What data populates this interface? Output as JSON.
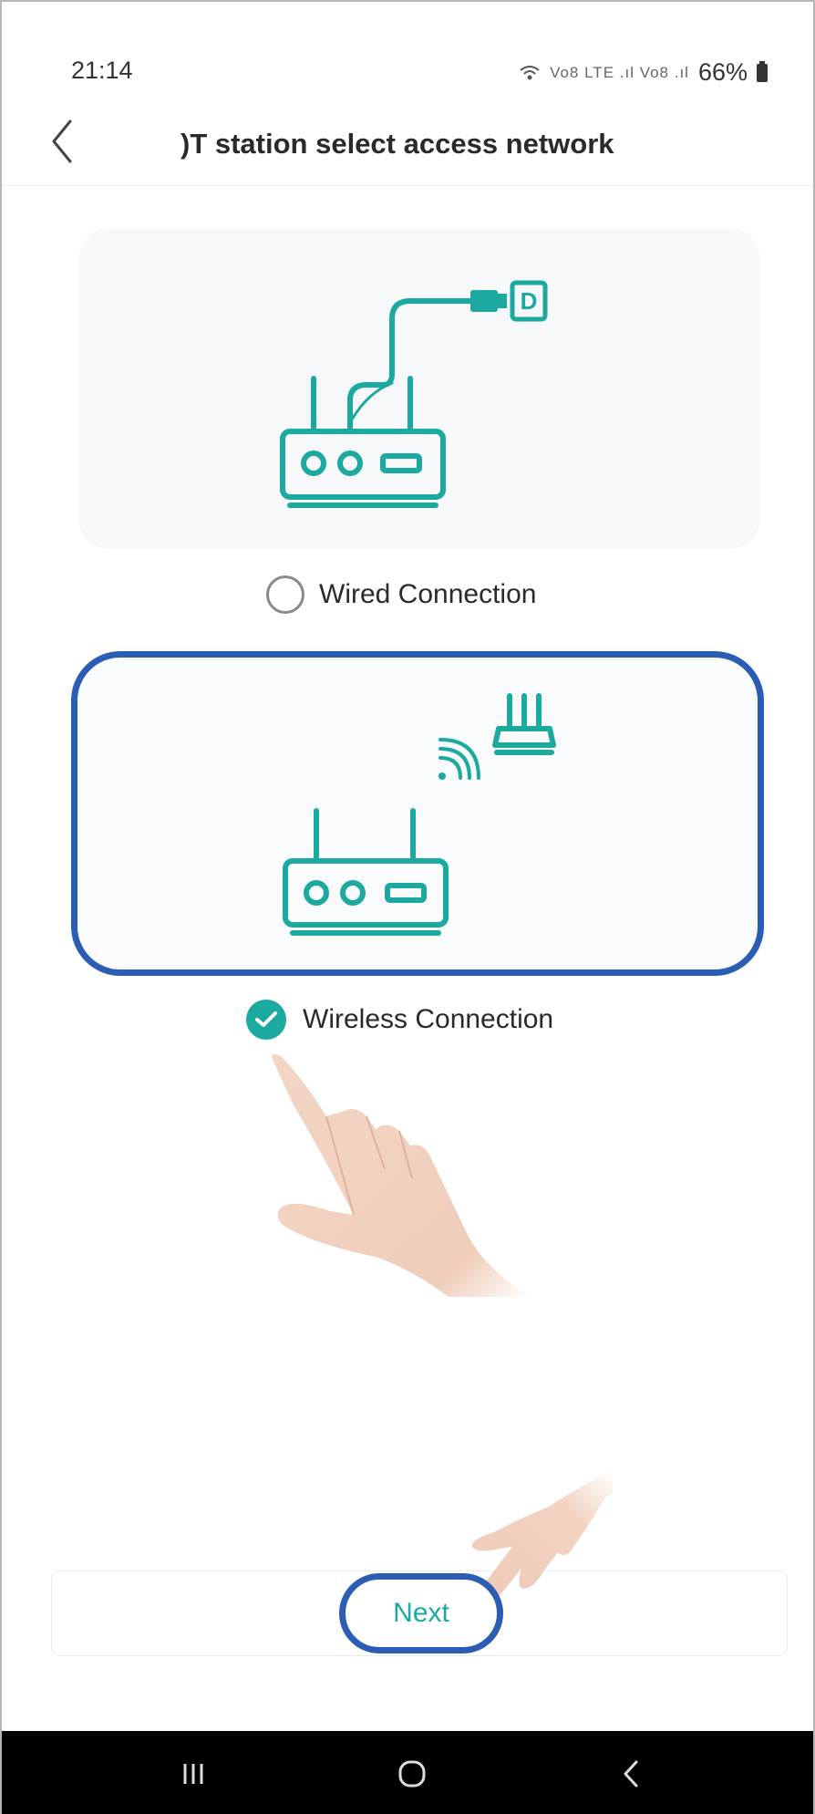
{
  "status_bar": {
    "time": "21:14",
    "network_info": "Vo8 LTE .ıl Vo8 .ıl",
    "battery_text": "66%"
  },
  "header": {
    "back_icon": "chevron-left-icon",
    "title": ")T station select access network"
  },
  "options": {
    "wired": {
      "label": "Wired Connection",
      "selected": false
    },
    "wireless": {
      "label": "Wireless Connection",
      "selected": true
    }
  },
  "footer": {
    "next_label": "Next"
  },
  "nav_bar": {
    "items": [
      "recents-icon",
      "home-icon",
      "back-icon"
    ]
  },
  "colors": {
    "accent": "#1ba9a0",
    "highlight": "#2b5db5",
    "card_bg": "#f6f8f9"
  }
}
